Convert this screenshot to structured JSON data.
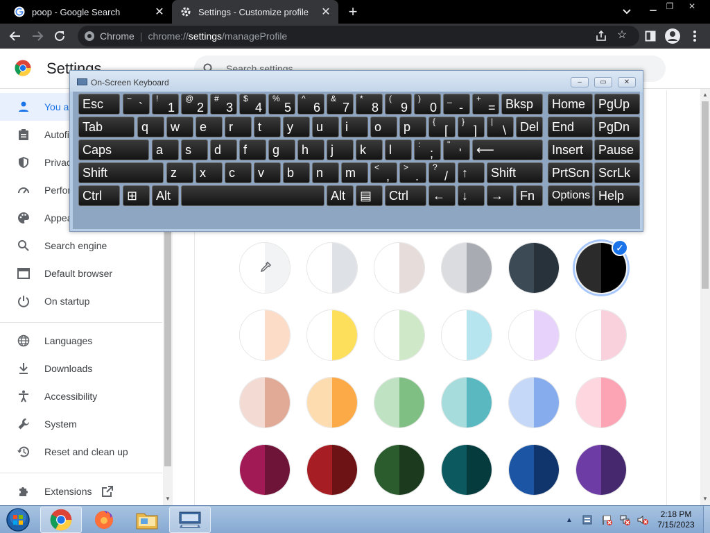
{
  "browser": {
    "tabs": [
      {
        "title": "poop - Google Search",
        "favicon": "google-g-icon"
      },
      {
        "title": "Settings - Customize profile",
        "favicon": "gear-icon"
      }
    ],
    "new_tab": "+",
    "omnibox": {
      "chip": "Chrome",
      "separator": "|",
      "url_prefix": "chrome://",
      "url_host": "settings",
      "url_path": "/manageProfile"
    }
  },
  "settings": {
    "title": "Settings",
    "search_placeholder": "Search settings",
    "sidebar": [
      {
        "label": "You and Google",
        "icon": "person-icon"
      },
      {
        "label": "Autofill",
        "icon": "clipboard-icon"
      },
      {
        "label": "Privacy and security",
        "icon": "shield-icon"
      },
      {
        "label": "Performance",
        "icon": "speedometer-icon"
      },
      {
        "label": "Appearance",
        "icon": "palette-icon"
      },
      {
        "label": "Search engine",
        "icon": "search-icon"
      },
      {
        "label": "Default browser",
        "icon": "browser-window-icon"
      },
      {
        "label": "On startup",
        "icon": "power-icon"
      },
      {
        "label": "Languages",
        "icon": "globe-icon"
      },
      {
        "label": "Downloads",
        "icon": "download-icon"
      },
      {
        "label": "Accessibility",
        "icon": "accessibility-icon"
      },
      {
        "label": "System",
        "icon": "wrench-icon"
      },
      {
        "label": "Reset and clean up",
        "icon": "restore-icon"
      },
      {
        "label": "Extensions",
        "icon": "puzzle-icon"
      }
    ],
    "theme_colors": [
      [
        [
          "#ffffff",
          "#f1f3f4"
        ],
        [
          "#ffffff",
          "#dee1e6"
        ],
        [
          "#ffffff",
          "#e6dcd9"
        ],
        [
          "#dadce0",
          "#a8abb1"
        ],
        [
          "#3c4a56",
          "#27323b"
        ],
        [
          "#2b2b2b",
          "#000000"
        ]
      ],
      [
        [
          "#ffffff",
          "#fcdcc6"
        ],
        [
          "#ffffff",
          "#fddf5c"
        ],
        [
          "#ffffff",
          "#cfe8c8"
        ],
        [
          "#ffffff",
          "#b6e5ef"
        ],
        [
          "#ffffff",
          "#e7d2fc"
        ],
        [
          "#ffffff",
          "#f8d1dd"
        ]
      ],
      [
        [
          "#f3dad3",
          "#e0aa96"
        ],
        [
          "#fddcaf",
          "#fca947"
        ],
        [
          "#bfe2c3",
          "#7fbf83"
        ],
        [
          "#a6dcdc",
          "#5ab9c0"
        ],
        [
          "#c6d8f7",
          "#86aced"
        ],
        [
          "#fdd6df",
          "#fca4b3"
        ]
      ],
      [
        [
          "#a11a55",
          "#6e1439"
        ],
        [
          "#a61d24",
          "#6d1316"
        ],
        [
          "#2a5c2e",
          "#1c3b1e"
        ],
        [
          "#0c5a60",
          "#063b3e"
        ],
        [
          "#1b55a4",
          "#0f356c"
        ],
        [
          "#6d3da5",
          "#45286e"
        ]
      ]
    ],
    "selected_color": "black"
  },
  "osk": {
    "title": "On-Screen Keyboard",
    "ctl_min": "‒",
    "ctl_max": "▭",
    "ctl_close": "✕",
    "rows": [
      [
        {
          "l": "Esc"
        },
        {
          "s": "~",
          "l": "`"
        },
        {
          "s": "!",
          "l": "1"
        },
        {
          "s": "@",
          "l": "2"
        },
        {
          "s": "#",
          "l": "3"
        },
        {
          "s": "$",
          "l": "4"
        },
        {
          "s": "%",
          "l": "5"
        },
        {
          "s": "^",
          "l": "6"
        },
        {
          "s": "&",
          "l": "7"
        },
        {
          "s": "*",
          "l": "8"
        },
        {
          "s": "(",
          "l": "9"
        },
        {
          "s": ")",
          "l": "0"
        },
        {
          "s": "_",
          "l": "-"
        },
        {
          "s": "+",
          "l": "="
        },
        {
          "l": "Bksp"
        },
        {
          "l": "Home"
        },
        {
          "l": "PgUp"
        }
      ],
      [
        {
          "l": "Tab"
        },
        {
          "l": "q"
        },
        {
          "l": "w"
        },
        {
          "l": "e"
        },
        {
          "l": "r"
        },
        {
          "l": "t"
        },
        {
          "l": "y"
        },
        {
          "l": "u"
        },
        {
          "l": "i"
        },
        {
          "l": "o"
        },
        {
          "l": "p"
        },
        {
          "s": "{",
          "l": "["
        },
        {
          "s": "}",
          "l": "]"
        },
        {
          "s": "|",
          "l": "\\"
        },
        {
          "l": "Del"
        },
        {
          "l": "End"
        },
        {
          "l": "PgDn"
        }
      ],
      [
        {
          "l": "Caps"
        },
        {
          "l": "a"
        },
        {
          "l": "s"
        },
        {
          "l": "d"
        },
        {
          "l": "f"
        },
        {
          "l": "g"
        },
        {
          "l": "h"
        },
        {
          "l": "j"
        },
        {
          "l": "k"
        },
        {
          "l": "l"
        },
        {
          "s": ":",
          "l": ";"
        },
        {
          "s": "\"",
          "l": "'"
        },
        {
          "l": "⟵"
        },
        {
          "l": "Insert"
        },
        {
          "l": "Pause"
        }
      ],
      [
        {
          "l": "Shift"
        },
        {
          "l": "z"
        },
        {
          "l": "x"
        },
        {
          "l": "c"
        },
        {
          "l": "v"
        },
        {
          "l": "b"
        },
        {
          "l": "n"
        },
        {
          "l": "m"
        },
        {
          "s": "<",
          "l": ","
        },
        {
          "s": ">",
          "l": "."
        },
        {
          "s": "?",
          "l": "/"
        },
        {
          "l": "↑"
        },
        {
          "l": "Shift"
        },
        {
          "l": "PrtScn"
        },
        {
          "l": "ScrLk"
        }
      ],
      [
        {
          "l": "Ctrl"
        },
        {
          "l": "⊞"
        },
        {
          "l": "Alt"
        },
        {
          "l": ""
        },
        {
          "l": "Alt"
        },
        {
          "l": "▤"
        },
        {
          "l": "Ctrl"
        },
        {
          "l": "←"
        },
        {
          "l": "↓"
        },
        {
          "l": "→"
        },
        {
          "l": "Fn"
        },
        {
          "l": "Options"
        },
        {
          "l": "Help"
        }
      ]
    ]
  },
  "taskbar": {
    "apps": [
      {
        "name": "chrome-taskbar-button",
        "active": true
      },
      {
        "name": "firefox-taskbar-button",
        "active": false
      },
      {
        "name": "explorer-taskbar-button",
        "active": false
      },
      {
        "name": "osk-taskbar-button",
        "active": true
      }
    ],
    "time": "2:18 PM",
    "date": "7/15/2023"
  }
}
